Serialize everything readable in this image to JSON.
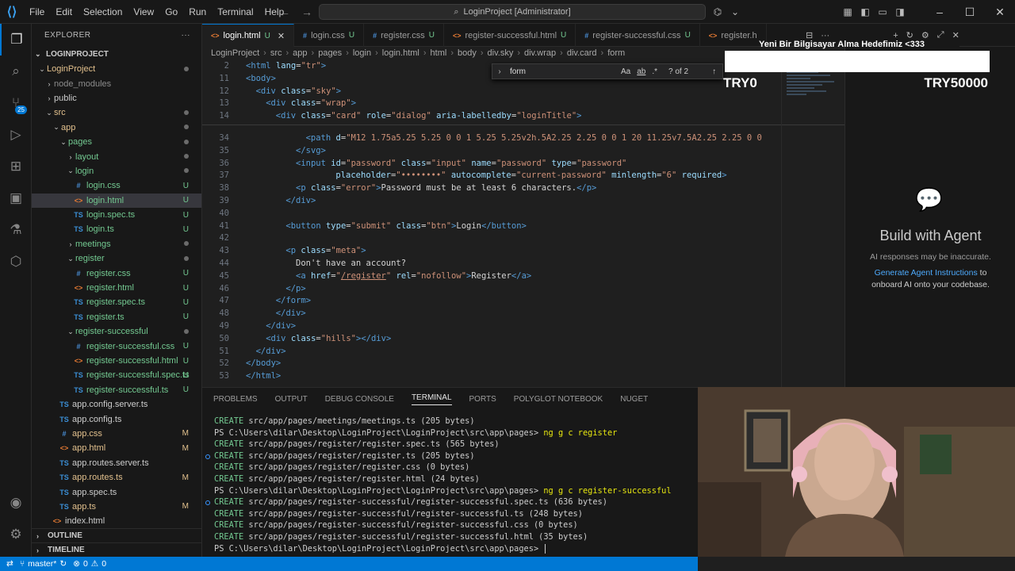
{
  "titlebar": {
    "menu": [
      "File",
      "Edit",
      "Selection",
      "View",
      "Go",
      "Run",
      "Terminal",
      "Help"
    ],
    "search_text": "LoginProject [Administrator]"
  },
  "activity": {
    "extensions_badge": "25"
  },
  "explorer": {
    "header": "EXPLORER",
    "project": "LOGINPROJECT",
    "items": [
      {
        "label": "LoginProject",
        "depth": 1,
        "type": "folder",
        "open": true,
        "status": "dot",
        "color": "yellow"
      },
      {
        "label": "node_modules",
        "depth": 2,
        "type": "folder",
        "open": false,
        "status": "",
        "color": "dim"
      },
      {
        "label": "public",
        "depth": 2,
        "type": "folder",
        "open": false,
        "status": "",
        "color": "normal"
      },
      {
        "label": "src",
        "depth": 2,
        "type": "folder",
        "open": true,
        "status": "dot",
        "color": "yellow"
      },
      {
        "label": "app",
        "depth": 3,
        "type": "folder",
        "open": true,
        "status": "dot",
        "color": "yellow"
      },
      {
        "label": "pages",
        "depth": 4,
        "type": "folder",
        "open": true,
        "status": "dot",
        "color": "green"
      },
      {
        "label": "layout",
        "depth": 5,
        "type": "folder",
        "open": false,
        "status": "dot",
        "color": "green"
      },
      {
        "label": "login",
        "depth": 5,
        "type": "folder",
        "open": true,
        "status": "dot",
        "color": "green"
      },
      {
        "label": "login.css",
        "depth": 6,
        "type": "css",
        "status": "U",
        "color": "green"
      },
      {
        "label": "login.html",
        "depth": 6,
        "type": "html",
        "status": "U",
        "color": "green",
        "selected": true
      },
      {
        "label": "login.spec.ts",
        "depth": 6,
        "type": "ts",
        "status": "U",
        "color": "green"
      },
      {
        "label": "login.ts",
        "depth": 6,
        "type": "ts",
        "status": "U",
        "color": "green"
      },
      {
        "label": "meetings",
        "depth": 5,
        "type": "folder",
        "open": false,
        "status": "dot",
        "color": "green"
      },
      {
        "label": "register",
        "depth": 5,
        "type": "folder",
        "open": true,
        "status": "dot",
        "color": "green"
      },
      {
        "label": "register.css",
        "depth": 6,
        "type": "css",
        "status": "U",
        "color": "green"
      },
      {
        "label": "register.html",
        "depth": 6,
        "type": "html",
        "status": "U",
        "color": "green"
      },
      {
        "label": "register.spec.ts",
        "depth": 6,
        "type": "ts",
        "status": "U",
        "color": "green"
      },
      {
        "label": "register.ts",
        "depth": 6,
        "type": "ts",
        "status": "U",
        "color": "green"
      },
      {
        "label": "register-successful",
        "depth": 5,
        "type": "folder",
        "open": true,
        "status": "dot",
        "color": "green"
      },
      {
        "label": "register-successful.css",
        "depth": 6,
        "type": "css",
        "status": "U",
        "color": "green"
      },
      {
        "label": "register-successful.html",
        "depth": 6,
        "type": "html",
        "status": "U",
        "color": "green"
      },
      {
        "label": "register-successful.spec.ts",
        "depth": 6,
        "type": "ts",
        "status": "U",
        "color": "green"
      },
      {
        "label": "register-successful.ts",
        "depth": 6,
        "type": "ts",
        "status": "U",
        "color": "green"
      },
      {
        "label": "app.config.server.ts",
        "depth": 4,
        "type": "ts",
        "status": "",
        "color": "normal"
      },
      {
        "label": "app.config.ts",
        "depth": 4,
        "type": "ts",
        "status": "",
        "color": "normal"
      },
      {
        "label": "app.css",
        "depth": 4,
        "type": "css",
        "status": "M",
        "color": "yellow"
      },
      {
        "label": "app.html",
        "depth": 4,
        "type": "html",
        "status": "M",
        "color": "yellow"
      },
      {
        "label": "app.routes.server.ts",
        "depth": 4,
        "type": "ts",
        "status": "",
        "color": "normal"
      },
      {
        "label": "app.routes.ts",
        "depth": 4,
        "type": "ts",
        "status": "M",
        "color": "yellow"
      },
      {
        "label": "app.spec.ts",
        "depth": 4,
        "type": "ts",
        "status": "",
        "color": "normal"
      },
      {
        "label": "app.ts",
        "depth": 4,
        "type": "ts",
        "status": "M",
        "color": "yellow"
      },
      {
        "label": "index.html",
        "depth": 3,
        "type": "html",
        "status": "",
        "color": "normal"
      }
    ],
    "outline": "OUTLINE",
    "timeline": "TIMELINE"
  },
  "tabs": [
    {
      "label": "login.html",
      "type": "html",
      "status": "U",
      "active": true
    },
    {
      "label": "login.css",
      "type": "css",
      "status": "U"
    },
    {
      "label": "register.css",
      "type": "css",
      "status": "U"
    },
    {
      "label": "register-successful.html",
      "type": "html",
      "status": "U"
    },
    {
      "label": "register-successful.css",
      "type": "css",
      "status": "U"
    },
    {
      "label": "register.h",
      "type": "html",
      "status": ""
    }
  ],
  "breadcrumb": [
    "LoginProject",
    "src",
    "app",
    "pages",
    "login",
    "login.html",
    "html",
    "body",
    "div.sky",
    "div.wrap",
    "div.card",
    "form"
  ],
  "find": {
    "value": "form",
    "result": "? of 2",
    "case": "Aa",
    "word": "ab"
  },
  "sticky_lines": [
    {
      "n": "2",
      "html": "<span class=t>&lt;html</span> <span class=a>lang</span>=<span class=s>\"tr\"</span><span class=t>&gt;</span>",
      "indent": 0
    },
    {
      "n": "11",
      "html": "<span class=t>&lt;body&gt;</span>",
      "indent": 0
    },
    {
      "n": "12",
      "html": "<span class=t>&lt;div</span> <span class=a>class</span>=<span class=s>\"sky\"</span><span class=t>&gt;</span>",
      "indent": 1
    },
    {
      "n": "13",
      "html": "<span class=t>&lt;div</span> <span class=a>class</span>=<span class=s>\"wrap\"</span><span class=t>&gt;</span>",
      "indent": 2
    },
    {
      "n": "14",
      "html": "<span class=t>&lt;div</span> <span class=a>class</span>=<span class=s>\"card\"</span> <span class=a>role</span>=<span class=s>\"dialog\"</span> <span class=a>aria-labelledby</span>=<span class=s>\"loginTitle\"</span><span class=t>&gt;</span>",
      "indent": 3
    }
  ],
  "code_lines": [
    {
      "n": "34",
      "html": "<span class=t>&lt;path</span> <span class=a>d</span>=<span class=s>\"M12 1.75a5.25 5.25 0 0 1 5.25 5.25v2h.5A2.25 2.25 0 0 1 20 11.25v7.5A2.25 2.25 0 0</span>",
      "indent": 6
    },
    {
      "n": "35",
      "html": "<span class=t>&lt;/svg&gt;</span>",
      "indent": 5
    },
    {
      "n": "36",
      "html": "<span class=t>&lt;input</span> <span class=a>id</span>=<span class=s>\"password\"</span> <span class=a>class</span>=<span class=s>\"input\"</span> <span class=a>name</span>=<span class=s>\"password\"</span> <span class=a>type</span>=<span class=s>\"password\"</span>",
      "indent": 5
    },
    {
      "n": "37",
      "html": "<span class=a>placeholder</span>=<span class=s>\"••••••••\"</span> <span class=a>autocomplete</span>=<span class=s>\"current-password\"</span> <span class=a>minlength</span>=<span class=s>\"6\"</span> <span class=a>required</span><span class=t>&gt;</span>",
      "indent": 9
    },
    {
      "n": "38",
      "html": "<span class=t>&lt;p</span> <span class=a>class</span>=<span class=s>\"error\"</span><span class=t>&gt;</span><span class=tx>Password must be at least 6 characters.</span><span class=t>&lt;/p&gt;</span>",
      "indent": 5
    },
    {
      "n": "39",
      "html": "<span class=t>&lt;/div&gt;</span>",
      "indent": 4
    },
    {
      "n": "40",
      "html": "",
      "indent": 0
    },
    {
      "n": "41",
      "html": "<span class=t>&lt;button</span> <span class=a>type</span>=<span class=s>\"submit\"</span> <span class=a>class</span>=<span class=s>\"btn\"</span><span class=t>&gt;</span><span class=tx>Login</span><span class=t>&lt;/button&gt;</span>",
      "indent": 4
    },
    {
      "n": "42",
      "html": "",
      "indent": 0
    },
    {
      "n": "43",
      "html": "<span class=t>&lt;p</span> <span class=a>class</span>=<span class=s>\"meta\"</span><span class=t>&gt;</span>",
      "indent": 4
    },
    {
      "n": "44",
      "html": "<span class=tx>Don't have an account?</span>",
      "indent": 5
    },
    {
      "n": "45",
      "html": "<span class=t>&lt;a</span> <span class=a>href</span>=<span class=s>\"<u>/register</u>\"</span> <span class=a>rel</span>=<span class=s>\"nofollow\"</span><span class=t>&gt;</span><span class=tx>Register</span><span class=t>&lt;/a&gt;</span>",
      "indent": 5
    },
    {
      "n": "46",
      "html": "<span class=t>&lt;/p&gt;</span>",
      "indent": 4
    },
    {
      "n": "47",
      "html": "<span class=t>&lt;/form&gt;</span>",
      "indent": 3
    },
    {
      "n": "48",
      "html": "<span class=t>&lt;/div&gt;</span>",
      "indent": 3
    },
    {
      "n": "49",
      "html": "<span class=t>&lt;/div&gt;</span>",
      "indent": 2
    },
    {
      "n": "50",
      "html": "<span class=t>&lt;div</span> <span class=a>class</span>=<span class=s>\"hills\"</span><span class=t>&gt;&lt;/div&gt;</span>",
      "indent": 2
    },
    {
      "n": "51",
      "html": "<span class=t>&lt;/div&gt;</span>",
      "indent": 1
    },
    {
      "n": "52",
      "html": "<span class=t>&lt;/body&gt;</span>",
      "indent": 0
    },
    {
      "n": "53",
      "html": "<span class=t>&lt;/html&gt;</span>",
      "indent": 0
    }
  ],
  "panel": {
    "tabs": [
      "PROBLEMS",
      "OUTPUT",
      "DEBUG CONSOLE",
      "TERMINAL",
      "PORTS",
      "POLYGLOT NOTEBOOK",
      "NUGET"
    ],
    "active_tab": "TERMINAL",
    "lines": [
      {
        "kind": "create",
        "text": "src/app/pages/meetings/meetings.ts (205 bytes)",
        "dot": false
      },
      {
        "kind": "prompt",
        "text": "PS C:\\Users\\dilar\\Desktop\\LoginProject\\LoginProject\\src\\app\\pages>",
        "cmd": "ng g c register",
        "dot": false
      },
      {
        "kind": "create",
        "text": "src/app/pages/register/register.spec.ts (565 bytes)",
        "dot": false
      },
      {
        "kind": "create",
        "text": "src/app/pages/register/register.ts (205 bytes)",
        "dot": true
      },
      {
        "kind": "create",
        "text": "src/app/pages/register/register.css (0 bytes)",
        "dot": false
      },
      {
        "kind": "create",
        "text": "src/app/pages/register/register.html (24 bytes)",
        "dot": false
      },
      {
        "kind": "prompt",
        "text": "PS C:\\Users\\dilar\\Desktop\\LoginProject\\LoginProject\\src\\app\\pages>",
        "cmd": "ng g c register-successful",
        "dot": false
      },
      {
        "kind": "create",
        "text": "src/app/pages/register-successful/register-successful.spec.ts (636 bytes)",
        "dot": true
      },
      {
        "kind": "create",
        "text": "src/app/pages/register-successful/register-successful.ts (248 bytes)",
        "dot": false
      },
      {
        "kind": "create",
        "text": "src/app/pages/register-successful/register-successful.css (0 bytes)",
        "dot": false
      },
      {
        "kind": "create",
        "text": "src/app/pages/register-successful/register-successful.html (35 bytes)",
        "dot": false
      },
      {
        "kind": "prompt",
        "text": "PS C:\\Users\\dilar\\Desktop\\LoginProject\\LoginProject\\src\\app\\pages>",
        "cmd": "",
        "dot": false
      }
    ],
    "create_word": "CREATE"
  },
  "agent": {
    "title": "Build with Agent",
    "subtitle": "AI responses may be inaccurate.",
    "link": "Generate Agent Instructions",
    "link_suffix": "to",
    "link_line2": "onboard AI onto your codebase."
  },
  "stream_overlay": {
    "goal_title": "Yeni Bir Bilgisayar Alma Hedefimiz <333",
    "left": "TRY0",
    "right": "TRY50000",
    "progress_fraction": 0
  },
  "statusbar": {
    "branch": "master*",
    "errors": "0",
    "warnings": "0"
  }
}
